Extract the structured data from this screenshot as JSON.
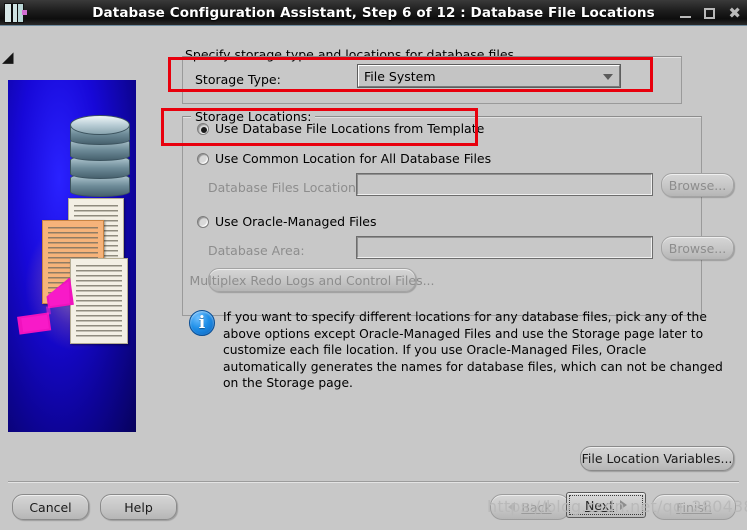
{
  "window": {
    "title": "Database Configuration Assistant, Step 6 of 12 : Database File Locations",
    "app_icon": "database-assistant-icon",
    "minimize": "minimize-icon",
    "maximize": "maximize-icon",
    "close": "close-icon"
  },
  "content": {
    "header_note": "Specify storage type and locations for database files",
    "storage_type": {
      "group_label": "",
      "label": "Storage Type:",
      "value": "File System",
      "dropdown_icon": "chevron-down-icon"
    },
    "storage_locations": {
      "group_label": "Storage Locations:",
      "options": [
        {
          "label": "Use Database File Locations from Template",
          "selected": true
        },
        {
          "label": "Use Common Location for All Database Files",
          "selected": false
        },
        {
          "label": "Use Oracle-Managed Files",
          "selected": false
        }
      ],
      "fields": [
        {
          "label": "Database Files Location:",
          "value": "",
          "placeholder": "",
          "browse": "Browse...",
          "disabled": true
        },
        {
          "label": "Database Area:",
          "value": "",
          "placeholder": "",
          "browse": "Browse...",
          "disabled": true
        }
      ],
      "multiplex_button": "Multiplex Redo Logs and Control Files..."
    },
    "info": {
      "icon": "info-icon",
      "text": "If you want to specify different locations for any database files, pick any of the above options except Oracle-Managed Files and use the Storage page later to customize each file location. If you use Oracle-Managed Files, Oracle automatically generates the names for database files, which can not be changed on the Storage page."
    }
  },
  "buttons": {
    "file_location_variables": "File Location Variables...",
    "cancel": "Cancel",
    "help": "Help",
    "back": "Back",
    "next": "Next",
    "finish": "Finish"
  },
  "annotations": {
    "highlight_color": "#e8000d",
    "boxes": [
      {
        "name": "storage-type-highlight"
      },
      {
        "name": "template-option-highlight"
      }
    ]
  },
  "watermark": "https://blog.csdn.net/qq_28043817"
}
